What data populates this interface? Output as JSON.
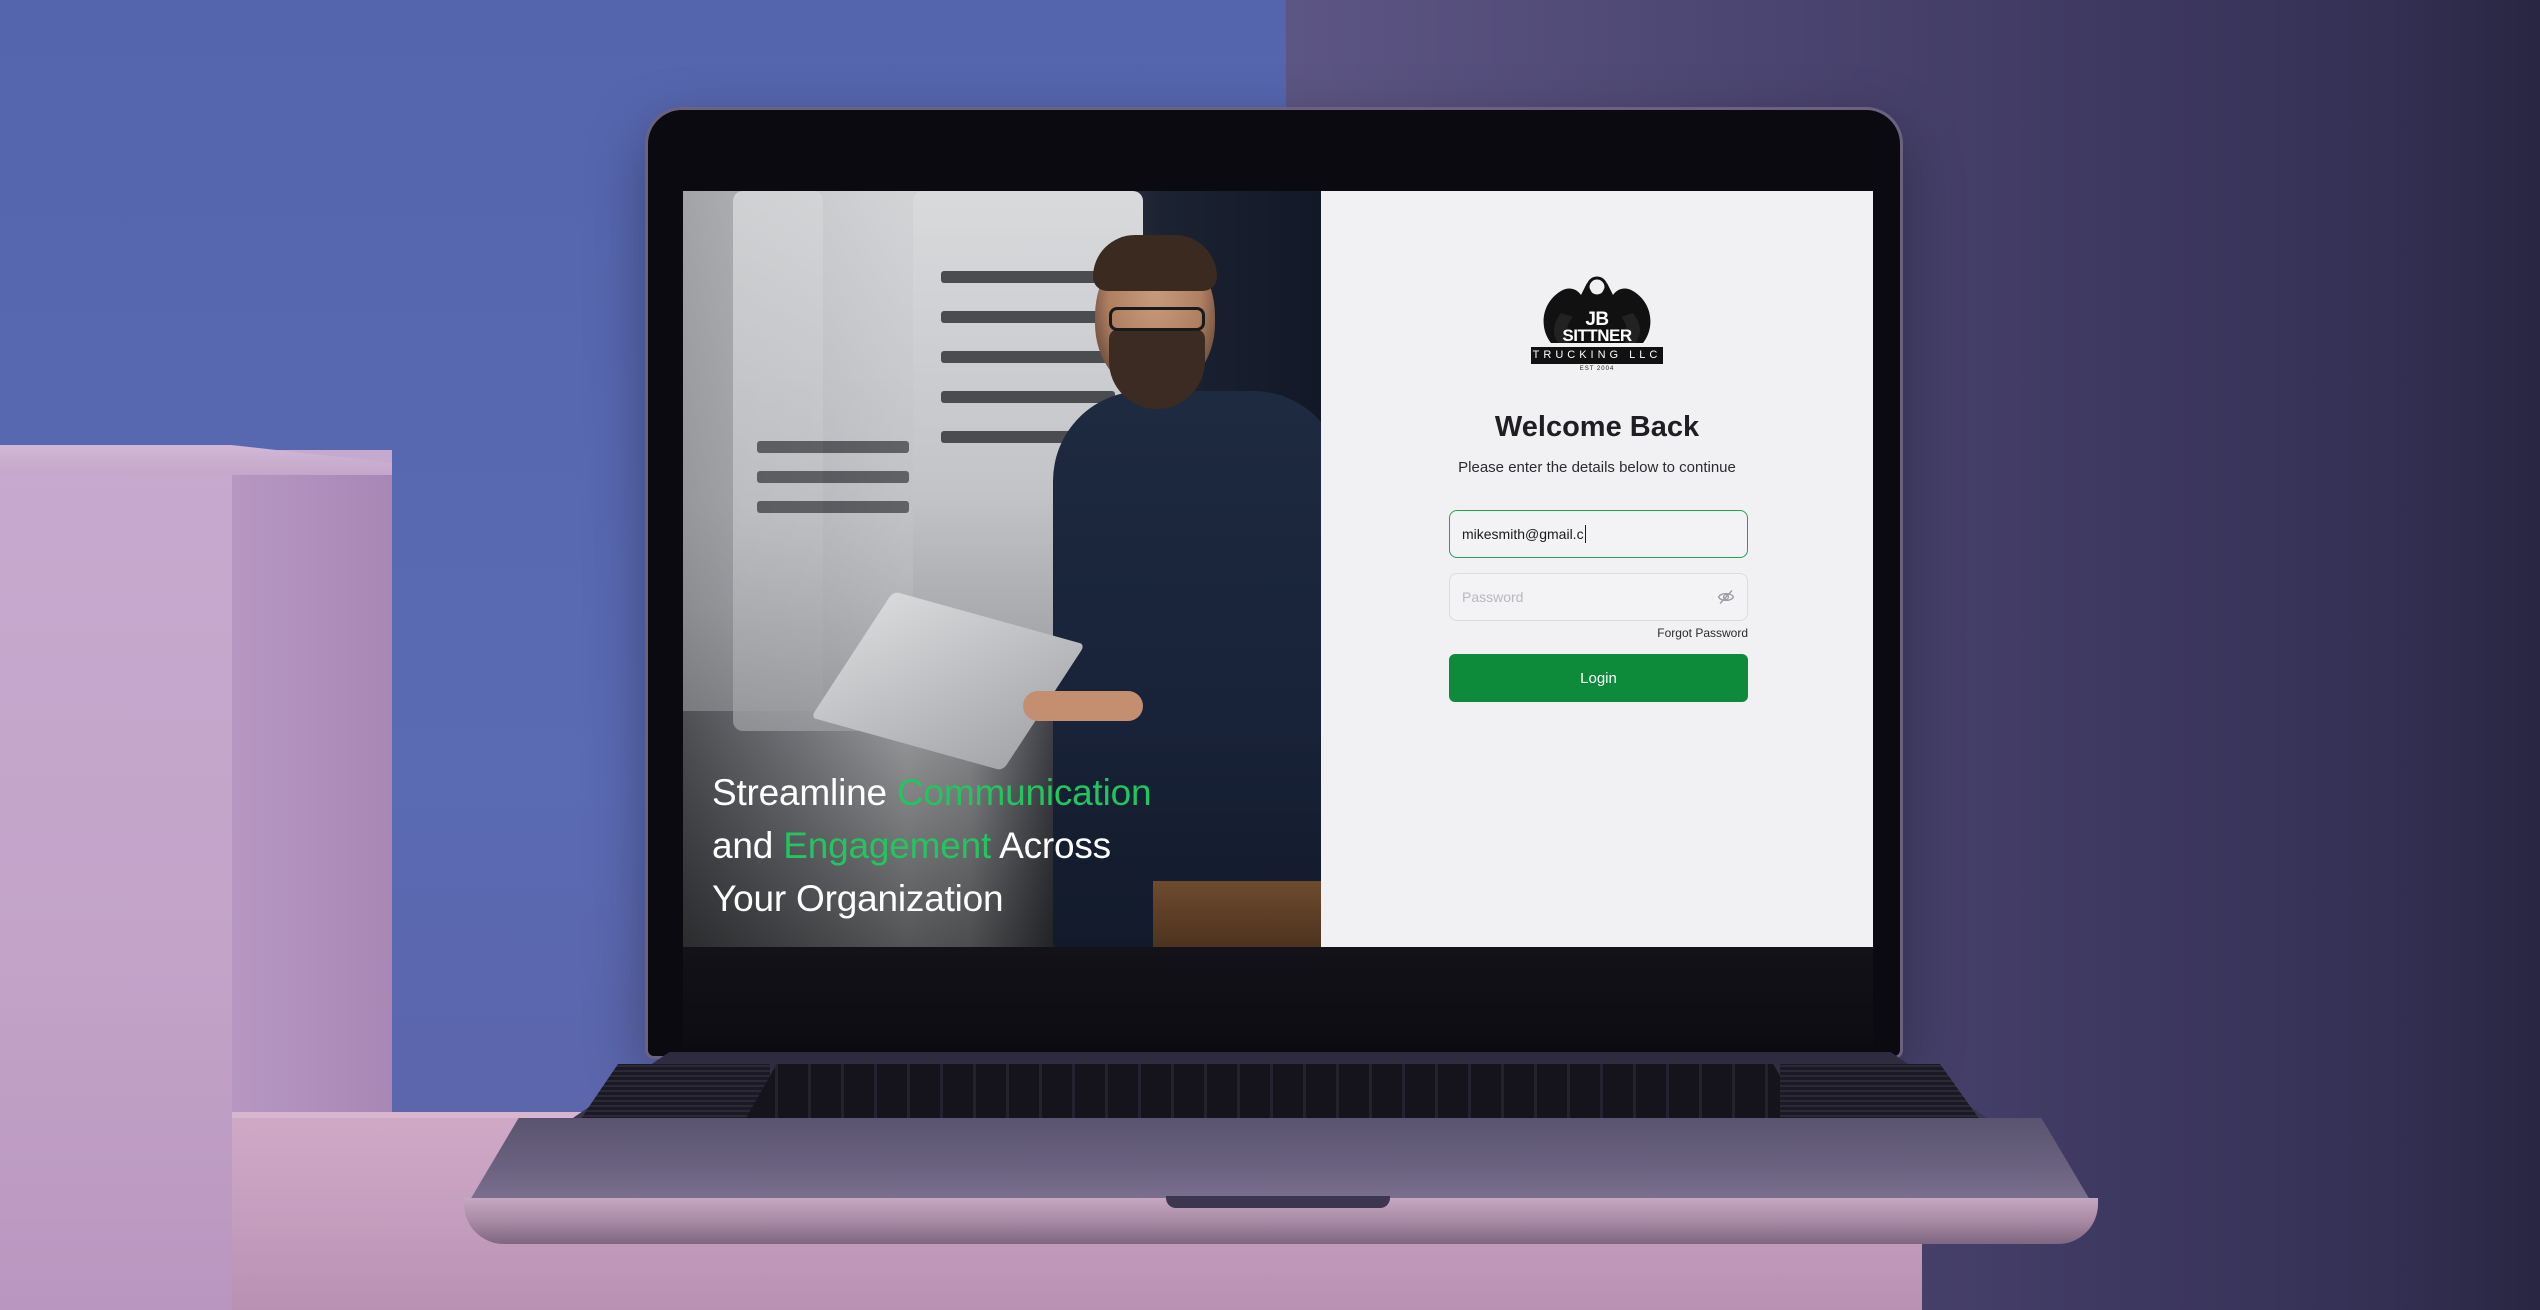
{
  "hero": {
    "tagline": {
      "line1_plain": "Streamline ",
      "line1_accent": "Communication",
      "line2_plain_before": "and ",
      "line2_accent": "Engagement",
      "line2_plain_after": " Across",
      "line3_plain": "Your Organization"
    }
  },
  "logo": {
    "line1": "JB",
    "line2": "SITTNER",
    "band": "TRUCKING LLC",
    "est": "EST 2004"
  },
  "login": {
    "title": "Welcome Back",
    "subtitle": "Please enter the details below to continue",
    "email_value": "mikesmith@gmail.c",
    "password_placeholder": "Password",
    "forgot_label": "Forgot Password",
    "login_label": "Login"
  },
  "icons": {
    "password_toggle": "eye-off-icon"
  },
  "colors": {
    "accent_green": "#22c55e",
    "button_green": "#0d8a3a",
    "focus_border": "#22a352"
  }
}
